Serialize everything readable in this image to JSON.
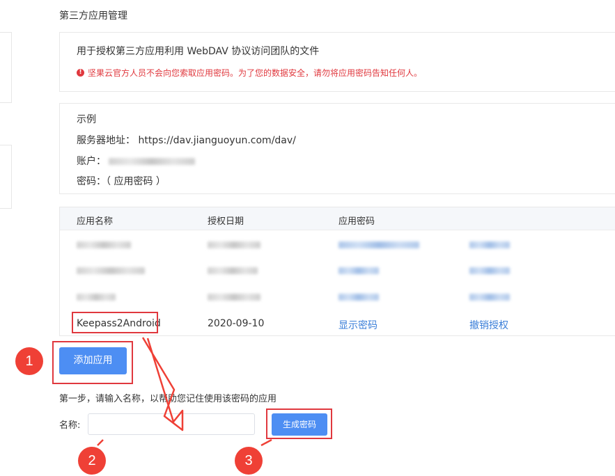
{
  "section_title": "第三方应用管理",
  "info": {
    "description": "用于授权第三方应用利用 WebDAV 协议访问团队的文件",
    "warning": "坚果云官方人员不会向您索取应用密码。为了您的数据安全，请勿将应用密码告知任何人。"
  },
  "example": {
    "title": "示例",
    "server_label": "服务器地址：",
    "server_url": "https://dav.jianguoyun.com/dav/",
    "account_label": "账户：",
    "password_label": "密码：（ 应用密码 ）"
  },
  "table": {
    "headers": [
      "应用名称",
      "授权日期",
      "应用密码"
    ],
    "last_row": {
      "name": "Keepass2Android",
      "date": "2020-09-10",
      "show_password": "显示密码",
      "revoke": "撤销授权"
    }
  },
  "add_app_button": "添加应用",
  "step_text": "第一步，请输入名称，以帮助您记住使用该密码的应用",
  "name_label": "名称:",
  "name_input_value": "",
  "generate_button": "生成密码",
  "badges": [
    "1",
    "2",
    "3"
  ],
  "colors": {
    "accent": "#4d8ef3",
    "link": "#3a7ed8",
    "warning": "#e0383e",
    "annotation": "#ef4036"
  }
}
